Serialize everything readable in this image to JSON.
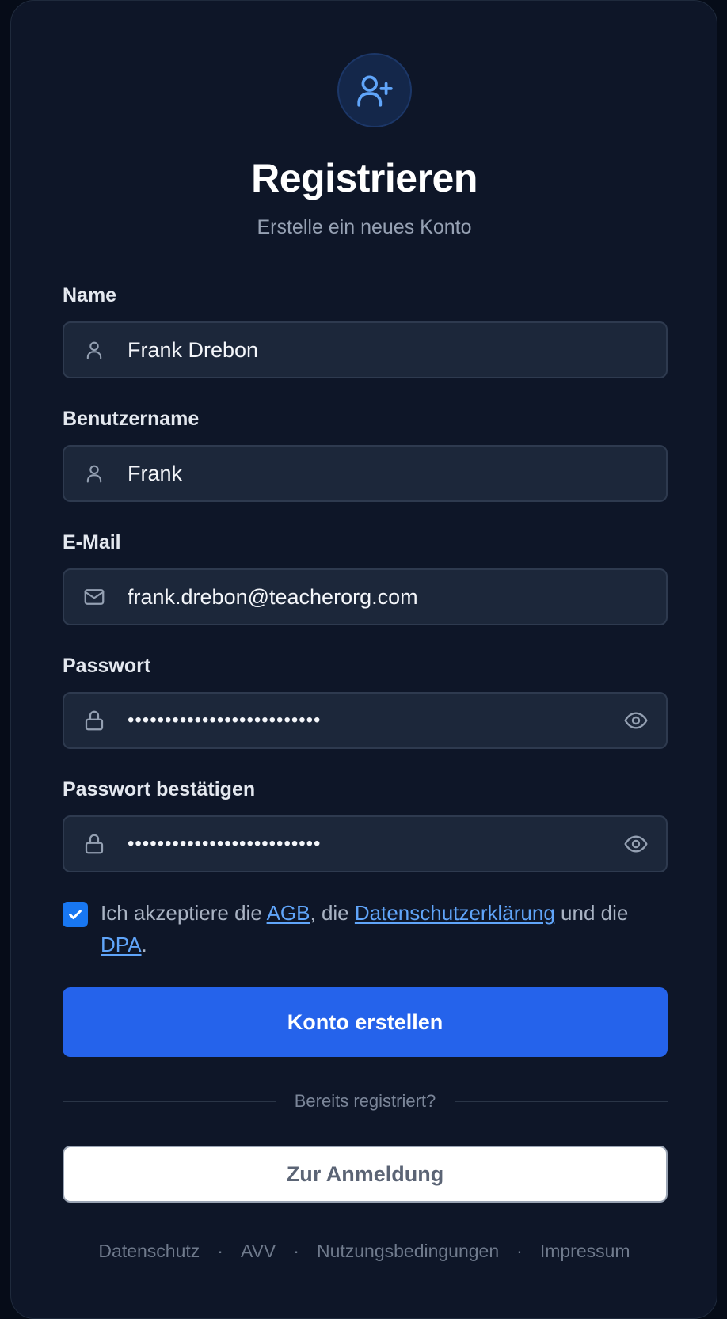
{
  "header": {
    "icon": "user-plus-icon",
    "title": "Registrieren",
    "subtitle": "Erstelle ein neues Konto"
  },
  "form": {
    "name": {
      "label": "Name",
      "value": "Frank Drebon",
      "icon": "user-icon"
    },
    "username": {
      "label": "Benutzername",
      "value": "Frank",
      "icon": "user-icon"
    },
    "email": {
      "label": "E-Mail",
      "value": "frank.drebon@teacherorg.com",
      "icon": "mail-icon"
    },
    "password": {
      "label": "Passwort",
      "value": "••••••••••••••••••••••••••",
      "icon": "lock-icon",
      "toggle_icon": "eye-icon"
    },
    "password_confirm": {
      "label": "Passwort bestätigen",
      "value": "••••••••••••••••••••••••••",
      "icon": "lock-icon",
      "toggle_icon": "eye-icon"
    },
    "terms": {
      "checked": true,
      "prefix": "Ich akzeptiere die ",
      "agb_link": "AGB",
      "mid1": ", die ",
      "privacy_link": "Datenschutzerklärung",
      "mid2": " und die ",
      "dpa_link": "DPA",
      "suffix": "."
    },
    "submit_label": "Konto erstellen"
  },
  "divider_text": "Bereits registriert?",
  "login_button_label": "Zur Anmeldung",
  "footer": {
    "links": [
      "Datenschutz",
      "AVV",
      "Nutzungsbedingungen",
      "Impressum"
    ],
    "separator": "·"
  },
  "colors": {
    "background": "#060c18",
    "card": "#0e1628",
    "input": "#1c273a",
    "accent": "#2563eb",
    "link": "#60a5fa",
    "checkbox": "#1877f2"
  }
}
